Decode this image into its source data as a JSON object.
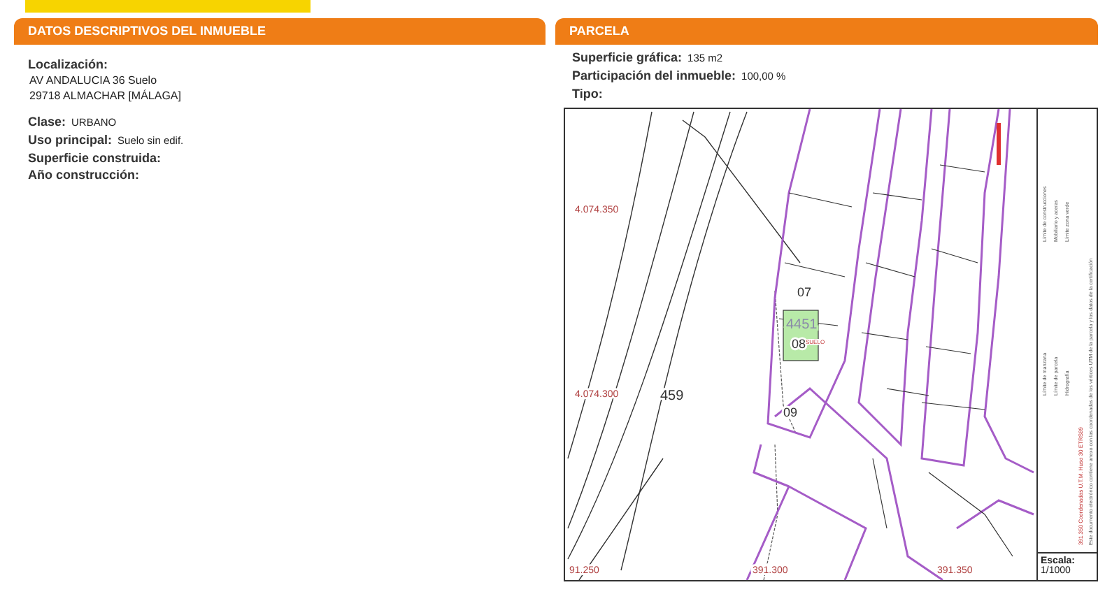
{
  "left_panel": {
    "title": "DATOS DESCRIPTIVOS DEL INMUEBLE",
    "location_label": "Localización:",
    "address_lines": [
      "AV ANDALUCIA 36 Suelo",
      "29718 ALMACHAR [MÁLAGA]"
    ],
    "fields": [
      {
        "label": "Clase:",
        "value": "URBANO"
      },
      {
        "label": "Uso principal:",
        "value": "Suelo sin edif."
      },
      {
        "label": "Superficie construida:"
      },
      {
        "label": "Año construcción:"
      }
    ]
  },
  "right_panel": {
    "title": "PARCELA",
    "fields": [
      {
        "label": "Superficie gráfica:",
        "value": "135 m2"
      },
      {
        "label": "Participación del inmueble:",
        "value": "100,00 %"
      },
      {
        "label": "Tipo:"
      }
    ],
    "map": {
      "coordinate_labels": [
        "4.074.350",
        "4.074.300",
        "91.250",
        "391.300",
        "391.350"
      ],
      "parcel_labels": [
        "459",
        "07",
        "4451",
        "08",
        "09"
      ],
      "selected_parcel_tag": "SUELO",
      "legend": [
        "Límite de manzana",
        "Límite de construcciones",
        "Límite de parcela",
        "Mobiliario y aceras",
        "Hidrografía",
        "Límite zona verde"
      ],
      "coordinates_note": "391.350 Coordenadas U.T.M. Huso 30 ETRS89",
      "note": "Este documento electrónico contiene anexo con las coordenadas de los vértices UTM de la parcela y los datos de la certificación",
      "scale_label": "Escala:",
      "scale_value": "1/1000"
    }
  }
}
